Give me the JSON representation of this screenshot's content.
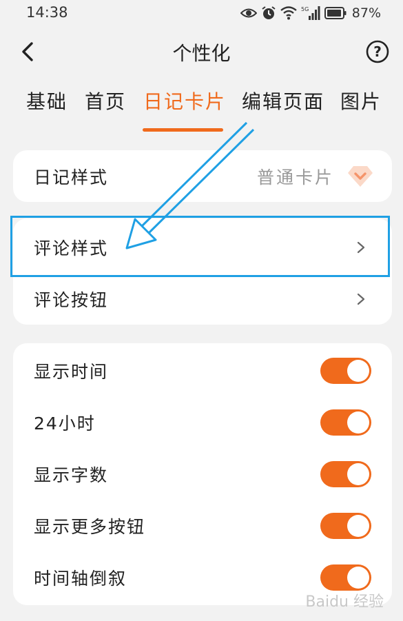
{
  "status_bar": {
    "time": "14:38",
    "battery": "87%",
    "network": "5G",
    "icons": [
      "eye-icon",
      "alarm-icon",
      "wifi-icon",
      "signal-icon",
      "battery-icon"
    ]
  },
  "header": {
    "title": "个性化",
    "back_icon": "back-arrow-icon",
    "help_icon": "help-icon",
    "help_glyph": "?"
  },
  "tabs": {
    "items": [
      "基础",
      "首页",
      "日记卡片",
      "编辑页面",
      "图片"
    ],
    "active": "日记卡片"
  },
  "card1": {
    "diary_style": {
      "label": "日记样式",
      "value": "普通卡片",
      "badge": "vip-diamond-icon"
    },
    "comment_style": {
      "label": "评论样式"
    },
    "comment_button": {
      "label": "评论按钮"
    }
  },
  "card2": {
    "items": [
      {
        "label": "显示时间",
        "enabled": true
      },
      {
        "label": "24小时",
        "enabled": true
      },
      {
        "label": "显示字数",
        "enabled": true
      },
      {
        "label": "显示更多按钮",
        "enabled": true
      },
      {
        "label": "时间轴倒叙",
        "enabled": true
      }
    ]
  },
  "watermark": "Baidu 经验",
  "colors": {
    "accent": "#f06a1c",
    "annotation": "#1fa0e4",
    "background": "#f2f2f2",
    "card": "#ffffff",
    "secondary_text": "#999999"
  }
}
